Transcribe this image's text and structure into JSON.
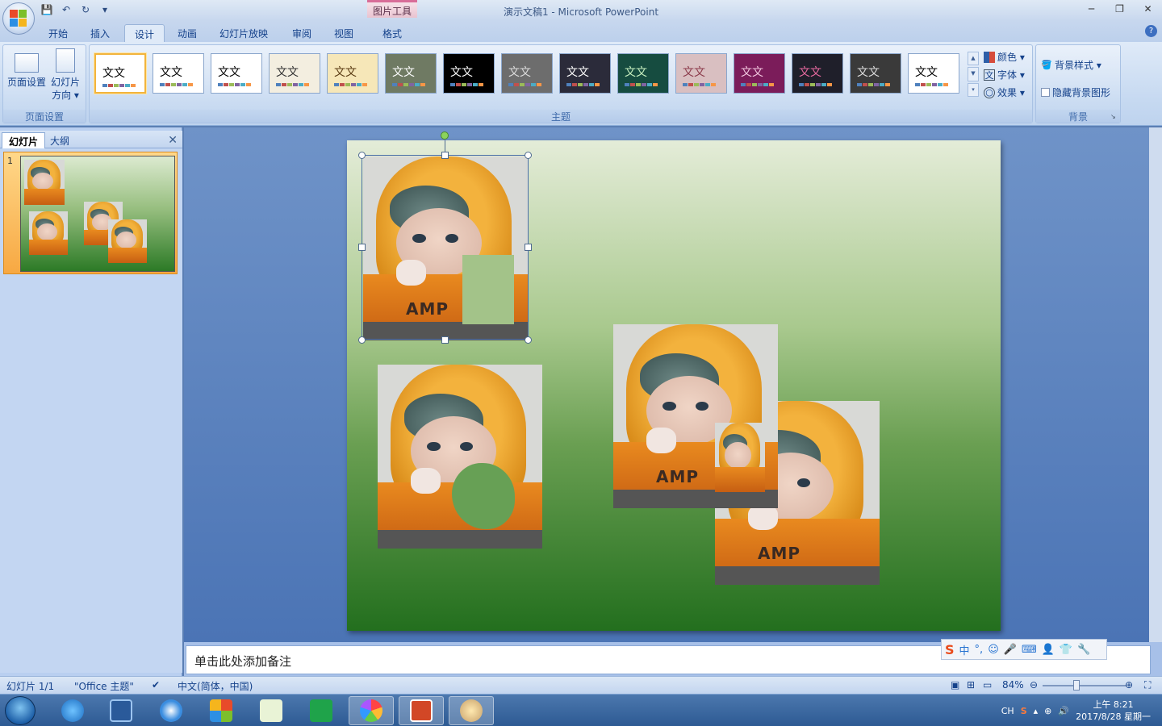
{
  "window": {
    "title": "演示文稿1 - Microsoft PowerPoint",
    "contextual_tab_group": "图片工具",
    "controls": [
      "─",
      "❐",
      "✕"
    ]
  },
  "tabs": [
    {
      "label": "开始"
    },
    {
      "label": "插入"
    },
    {
      "label": "设计",
      "active": true
    },
    {
      "label": "动画"
    },
    {
      "label": "幻灯片放映"
    },
    {
      "label": "审阅"
    },
    {
      "label": "视图"
    },
    {
      "label": "格式"
    }
  ],
  "ribbon": {
    "page_setup": {
      "group_label": "页面设置",
      "page_setup_label": "页面设置",
      "orientation_label_1": "幻灯片",
      "orientation_label_2": "方向 ▾"
    },
    "themes": {
      "group_label": "主题",
      "sample_text": "文文",
      "items": [
        {
          "bg": "#ffffff",
          "fg": "#000000",
          "selected": true
        },
        {
          "bg": "#ffffff",
          "fg": "#000000"
        },
        {
          "bg": "#ffffff",
          "fg": "#000000"
        },
        {
          "bg": "#f3eee0",
          "fg": "#333333"
        },
        {
          "bg": "#f6e7b8",
          "fg": "#5a3b13"
        },
        {
          "bg": "#6f7a63",
          "fg": "#ffffff"
        },
        {
          "bg": "#000000",
          "fg": "#ffffff"
        },
        {
          "bg": "#6d6d6d",
          "fg": "#dddddd"
        },
        {
          "bg": "#2b2b3a",
          "fg": "#ffffff"
        },
        {
          "bg": "#164c40",
          "fg": "#c8f0c0"
        },
        {
          "bg": "#d9bfc1",
          "fg": "#8b3a4a"
        },
        {
          "bg": "#7b1c5a",
          "fg": "#f2c6df"
        },
        {
          "bg": "#1f1f2a",
          "fg": "#e86aa0"
        },
        {
          "bg": "#3a3a3a",
          "fg": "#dddddd"
        },
        {
          "bg": "#ffffff",
          "fg": "#000000"
        }
      ],
      "colors_label": "颜色 ▾",
      "fonts_label": "字体 ▾",
      "effects_label": "效果 ▾"
    },
    "background": {
      "group_label": "背景",
      "styles_label": "背景样式 ▾",
      "hide_graphics_label": "隐藏背景图形"
    }
  },
  "left_panel": {
    "tab_slides": "幻灯片",
    "tab_outline": "大纲",
    "close": "✕",
    "slide_number": "1"
  },
  "slide": {
    "shirt_text": "AMP"
  },
  "notes": {
    "placeholder": "单击此处添加备注",
    "ime_label": "中"
  },
  "status": {
    "slide_count": "幻灯片 1/1",
    "theme": "\"Office 主题\"",
    "language": "中文(简体，中国)",
    "zoom": "84%",
    "zoom_minus": "⊖",
    "zoom_plus": "⊕"
  },
  "taskbar": {
    "tray_lang": "CH",
    "time": "上午 8:21",
    "date": "2017/8/28 星期一"
  }
}
